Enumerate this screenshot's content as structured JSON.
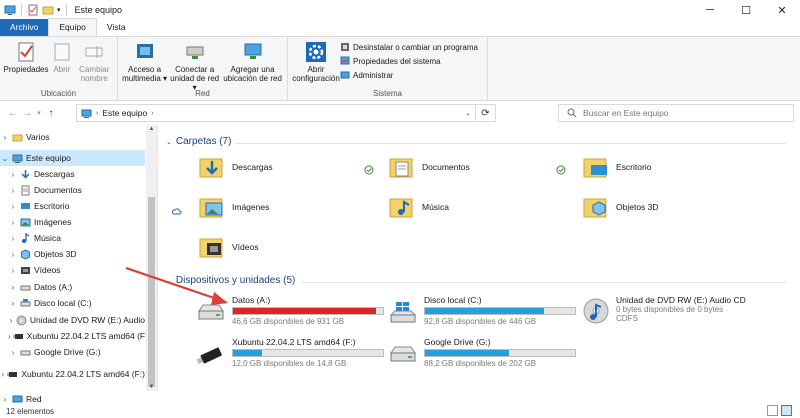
{
  "window": {
    "title": "Este equipo",
    "minimize": "─",
    "maximize": "☐",
    "close": "✕"
  },
  "tabs": [
    {
      "label": "Archivo"
    },
    {
      "label": "Equipo"
    },
    {
      "label": "Vista"
    }
  ],
  "ribbon": {
    "groups": [
      {
        "label": "Ubicación"
      },
      {
        "label": "Red"
      },
      {
        "label": "Sistema"
      }
    ],
    "buttons": {
      "propiedades": "Propiedades",
      "abrir": "Abrir",
      "cambiar_nombre": "Cambiar nombre",
      "acceso_multimedia": "Acceso a multimedia ▾",
      "conectar_red": "Conectar a unidad de red ▾",
      "agregar_ubicacion": "Agregar una ubicación de red",
      "abrir_config": "Abrir configuración"
    },
    "small": [
      "Desinstalar o cambiar un programa",
      "Propiedades del sistema",
      "Administrar"
    ]
  },
  "address": {
    "breadcrumb": "Este equipo",
    "search_placeholder": "Buscar en Este equipo"
  },
  "sidebar": {
    "items": [
      {
        "label": "Varios"
      },
      {
        "label": "Este equipo"
      },
      {
        "label": "Descargas"
      },
      {
        "label": "Documentos"
      },
      {
        "label": "Escritorio"
      },
      {
        "label": "Imágenes"
      },
      {
        "label": "Música"
      },
      {
        "label": "Objetos 3D"
      },
      {
        "label": "Vídeos"
      },
      {
        "label": "Datos (A:)"
      },
      {
        "label": "Disco local (C:)"
      },
      {
        "label": "Unidad de DVD RW (E:) Audio"
      },
      {
        "label": "Xubuntu 22.04.2 LTS amd64 (F:"
      },
      {
        "label": "Google Drive (G:)"
      },
      {
        "label": "Xubuntu 22.04.2 LTS amd64 (F:)"
      },
      {
        "label": "Red"
      }
    ]
  },
  "content": {
    "folders_header": "Carpetas (7)",
    "folders": [
      {
        "label": "Descargas"
      },
      {
        "label": "Documentos"
      },
      {
        "label": "Escritorio"
      },
      {
        "label": "Imágenes"
      },
      {
        "label": "Música"
      },
      {
        "label": "Objetos 3D"
      },
      {
        "label": "Vídeos"
      }
    ],
    "drives_header": "Dispositivos y unidades (5)",
    "drives": [
      {
        "label": "Datos (A:)",
        "sub": "46,6 GB disponibles de 931 GB",
        "used_fraction": 0.95,
        "color": "#da2626"
      },
      {
        "label": "Disco local (C:)",
        "sub": "92,8 GB disponibles de 446 GB",
        "used_fraction": 0.79,
        "color": "#26a0da"
      },
      {
        "label": "Unidad de DVD RW (E:) Audio CD",
        "sub": "0 bytes disponibles de 0 bytes",
        "sub2": "CDFS"
      },
      {
        "label": "Xubuntu 22.04.2 LTS amd64 (F:)",
        "sub": "12,0 GB disponibles de 14,8 GB",
        "used_fraction": 0.19,
        "color": "#26a0da"
      },
      {
        "label": "Google Drive (G:)",
        "sub": "88,2 GB disponibles de 202 GB",
        "used_fraction": 0.56,
        "color": "#26a0da"
      }
    ]
  },
  "status": {
    "count": "12 elementos"
  },
  "colors": {
    "accent": "#1e69b8",
    "selection": "#cce8ff",
    "annotation_arrow": "#d9403a"
  }
}
